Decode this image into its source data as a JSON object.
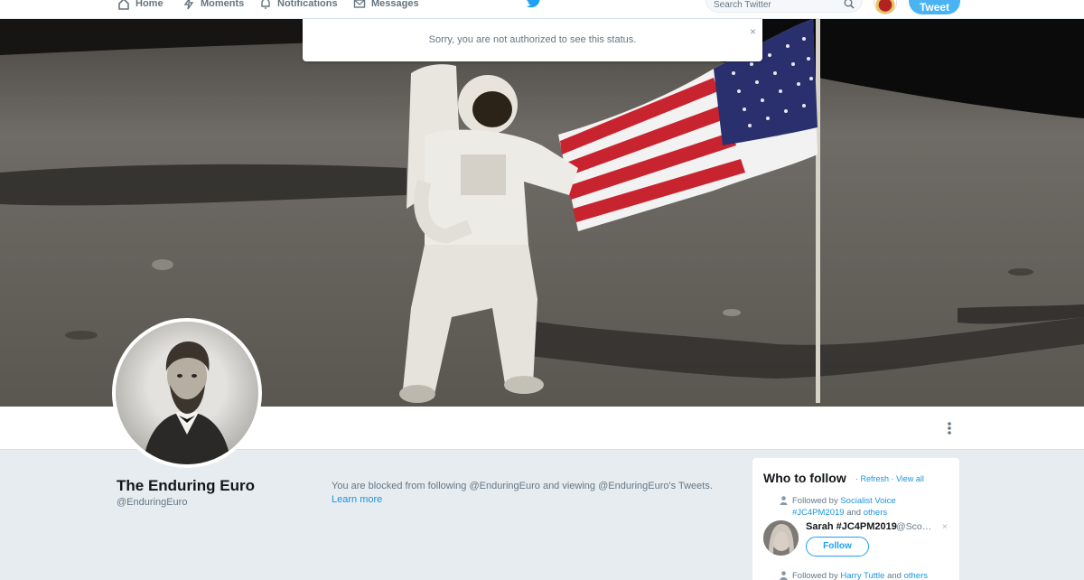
{
  "nav": {
    "home": "Home",
    "moments": "Moments",
    "notifications": "Notifications",
    "messages": "Messages",
    "search_placeholder": "Search Twitter",
    "tweet_button": "Tweet"
  },
  "alert": {
    "message": "Sorry, you are not authorized to see this status.",
    "close": "×"
  },
  "profile": {
    "name": "The Enduring Euro",
    "handle": "@EnduringEuro"
  },
  "blocked": {
    "message": "You are blocked from following @EnduringEuro and viewing @EnduringEuro's Tweets.",
    "learn_more": "Learn more"
  },
  "who_to_follow": {
    "title": "Who to follow",
    "separator": "·",
    "refresh": "Refresh",
    "view_all": "View all",
    "suggestions": [
      {
        "followed_by_prefix": "Followed by",
        "followed_by_names": "Socialist Voice #JC4PM2019",
        "followed_by_and": "and",
        "followed_by_others": "others",
        "name": "Sarah #JC4PM2019",
        "handle": "@Sco…",
        "follow_label": "Follow",
        "dismiss": "×"
      },
      {
        "followed_by_prefix": "Followed by",
        "followed_by_names": "Harry Tuttle",
        "followed_by_and": "and",
        "followed_by_others": "others"
      }
    ]
  },
  "colors": {
    "accent": "#1da1f2",
    "link": "#1b95e0",
    "page_background": "#e6ecf0",
    "muted_text": "#657786"
  }
}
